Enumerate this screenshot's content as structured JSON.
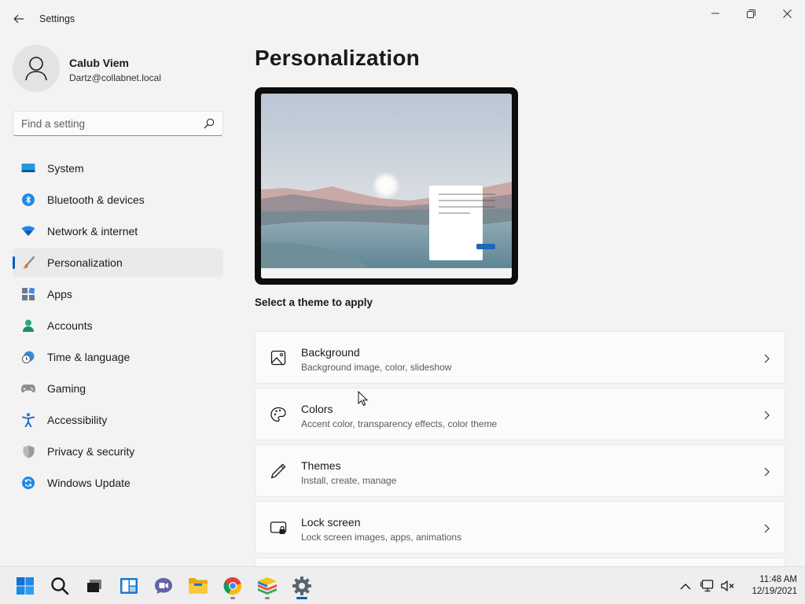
{
  "window": {
    "title": "Settings"
  },
  "profile": {
    "name": "Calub Viem",
    "email": "Dartz@collabnet.local"
  },
  "search": {
    "placeholder": "Find a setting"
  },
  "nav": {
    "items": [
      {
        "label": "System",
        "icon": "system-icon"
      },
      {
        "label": "Bluetooth & devices",
        "icon": "bluetooth-icon"
      },
      {
        "label": "Network & internet",
        "icon": "network-wifi-icon"
      },
      {
        "label": "Personalization",
        "icon": "brush-icon",
        "active": true
      },
      {
        "label": "Apps",
        "icon": "apps-icon"
      },
      {
        "label": "Accounts",
        "icon": "accounts-icon"
      },
      {
        "label": "Time & language",
        "icon": "time-language-icon"
      },
      {
        "label": "Gaming",
        "icon": "gamepad-icon"
      },
      {
        "label": "Accessibility",
        "icon": "accessibility-icon"
      },
      {
        "label": "Privacy & security",
        "icon": "shield-icon"
      },
      {
        "label": "Windows Update",
        "icon": "update-icon"
      }
    ]
  },
  "main": {
    "title": "Personalization",
    "theme_label": "Select a theme to apply",
    "cards": [
      {
        "title": "Background",
        "subtitle": "Background image, color, slideshow",
        "icon": "image-icon"
      },
      {
        "title": "Colors",
        "subtitle": "Accent color, transparency effects, color theme",
        "icon": "palette-icon"
      },
      {
        "title": "Themes",
        "subtitle": "Install, create, manage",
        "icon": "pen-icon"
      },
      {
        "title": "Lock screen",
        "subtitle": "Lock screen images, apps, animations",
        "icon": "lock-screen-icon"
      }
    ]
  },
  "taskbar": {
    "apps": [
      "start-icon",
      "search-icon",
      "task-view-icon",
      "widgets-icon",
      "teams-chat-icon",
      "file-explorer-icon",
      "chrome-icon",
      "bluestacks-icon",
      "settings-gear-icon"
    ],
    "clock": {
      "time": "11:48 AM",
      "date": "12/19/2021"
    }
  },
  "colors": {
    "accent": "#005fb8",
    "window_bg": "#f3f3f3",
    "card_bg": "#fbfbfb"
  }
}
